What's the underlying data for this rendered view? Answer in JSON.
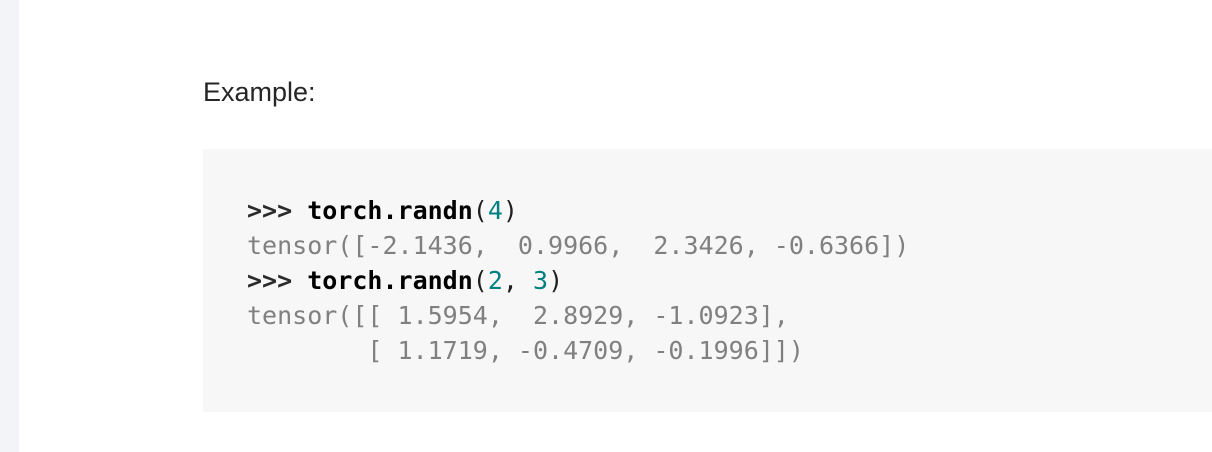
{
  "section": {
    "label": "Example:"
  },
  "code": {
    "line1": {
      "prompt": ">>> ",
      "func": "torch.randn",
      "open": "(",
      "arg1": "4",
      "close": ")"
    },
    "line2": {
      "output": "tensor([-2.1436,  0.9966,  2.3426, -0.6366])"
    },
    "line3": {
      "prompt": ">>> ",
      "func": "torch.randn",
      "open": "(",
      "arg1": "2",
      "sep": ", ",
      "arg2": "3",
      "close": ")"
    },
    "line4": {
      "output": "tensor([[ 1.5954,  2.8929, -1.0923],"
    },
    "line5": {
      "output": "        [ 1.1719, -0.4709, -0.1996]])"
    }
  },
  "colors": {
    "background": "#ffffff",
    "code_background": "#f7f7f7",
    "output_text": "#808080",
    "number": "#008080"
  }
}
